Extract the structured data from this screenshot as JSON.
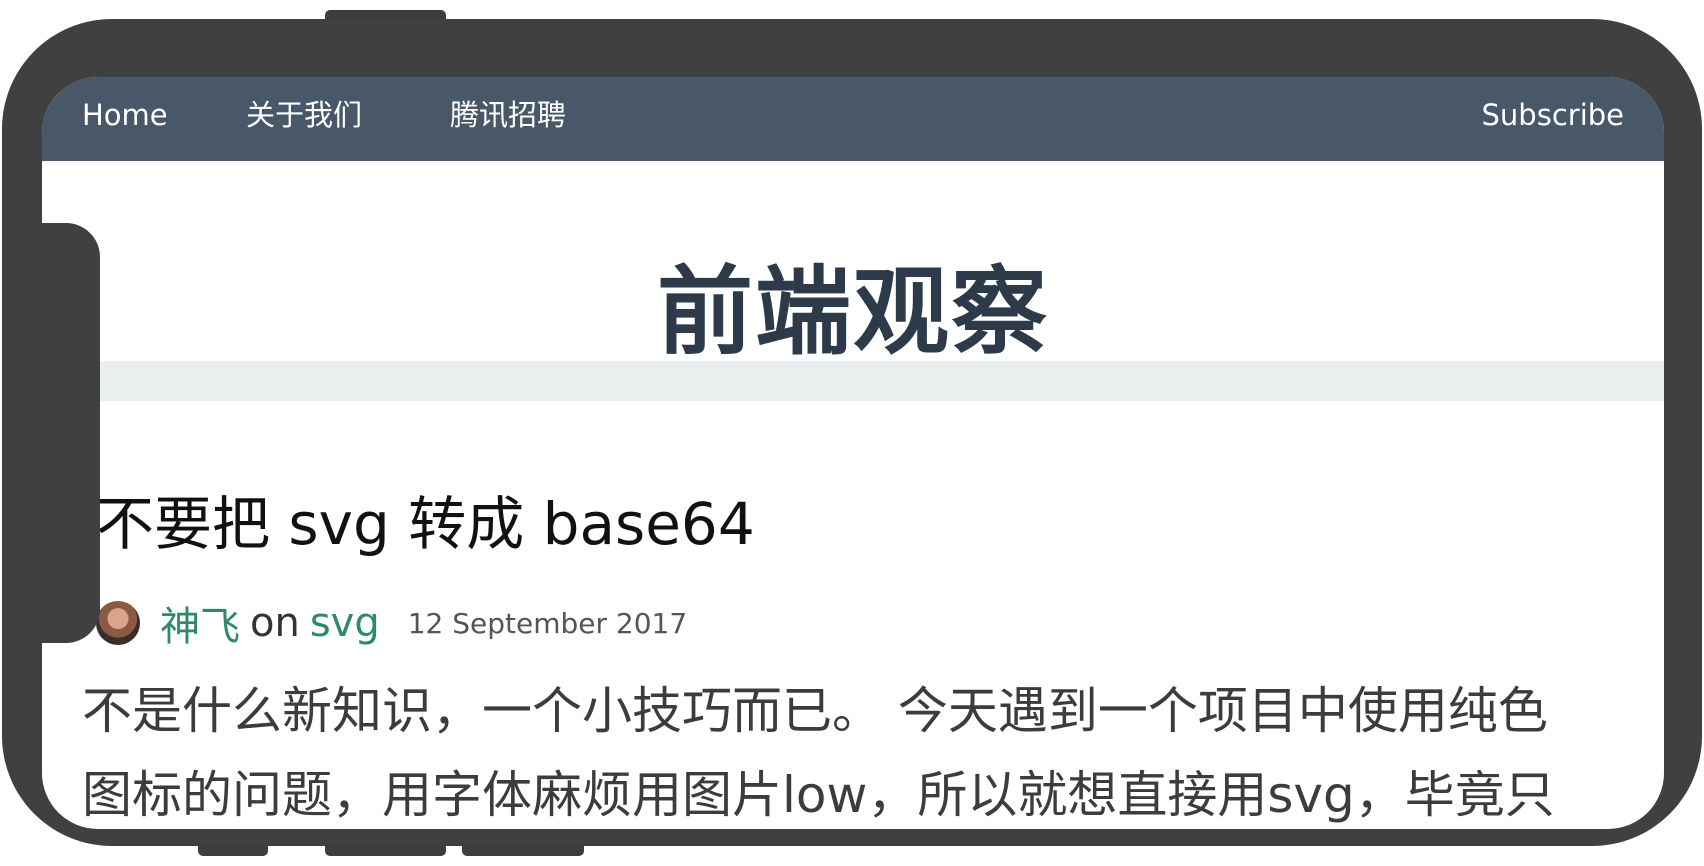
{
  "nav": {
    "home": "Home",
    "about": "关于我们",
    "jobs": "腾讯招聘",
    "subscribe": "Subscribe"
  },
  "site": {
    "title": "前端观察"
  },
  "post": {
    "title": "不要把 svg 转成 base64",
    "author": "神飞",
    "on": "on",
    "tag": "svg",
    "date": "12 September 2017",
    "excerpt_line1": "不是什么新知识，一个小技巧而已。 今天遇到一个项目中使用纯色",
    "excerpt_line2": "图标的问题，用字体麻烦用图片low，所以就想直接用svg，毕竟只"
  },
  "colors": {
    "navbar": "#485868",
    "title": "#2c3a49",
    "link": "#2f8a6a",
    "bezel": "#404040"
  }
}
